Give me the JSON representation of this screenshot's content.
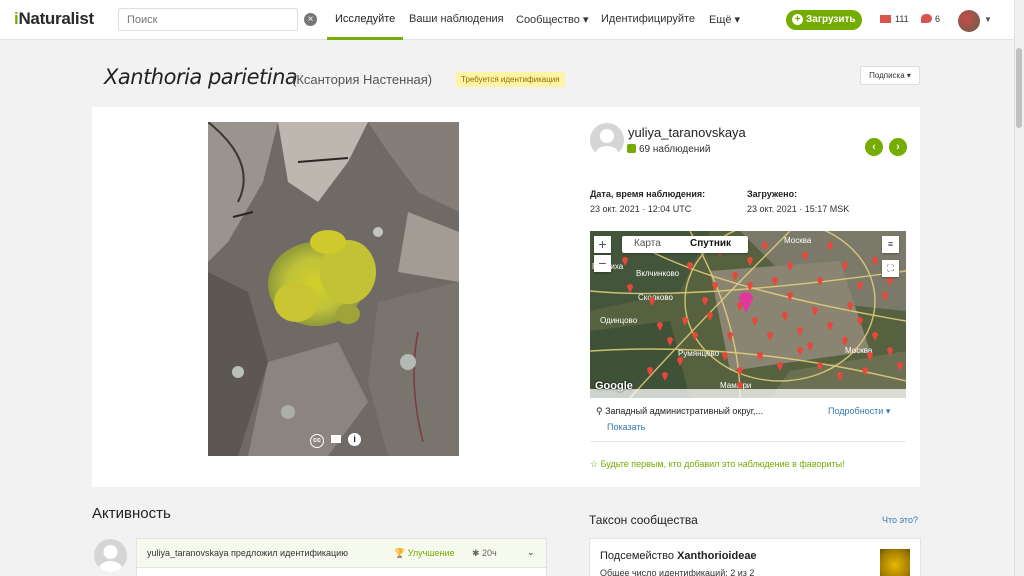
{
  "nav": {
    "logo_i": "i",
    "logo_rest": "Naturalist",
    "search_placeholder": "Поиск",
    "links": [
      "Исследуйте",
      "Ваши наблюдения",
      "Сообщество ▾",
      "Идентифицируйте",
      "Ещё ▾"
    ],
    "upload_label": "Загрузить",
    "messages_count": "111",
    "notifications_count": "6"
  },
  "observation": {
    "scientific_name": "Xanthoria parietina",
    "common_name": "(Ксантория Настенная)",
    "quality_badge": "Требуется идентификация",
    "subscribe_label": "Подписка ▾",
    "user_name": "yuliya_taranovskaya",
    "user_obs_count": "69 наблюдений",
    "date_label": "Дата, время наблюдения:",
    "date_value": "23 окт. 2021 · 12:04 UTC",
    "uploaded_label": "Загружено:",
    "uploaded_value": "23 окт. 2021 · 15:17 MSK",
    "photo_cc": "cc",
    "photo_info": "i"
  },
  "map": {
    "tab_map": "Карта",
    "tab_satellite": "Спутник",
    "zoom_in": "+",
    "zoom_out": "−",
    "layers_icon": "layers-icon",
    "fullscreen_icon": "fullscreen-icon",
    "google_label": "Google",
    "place": "Западный административный округ,...",
    "details_link": "Подробности ▾",
    "show_link": "Показать",
    "city_labels": [
      "Москва",
      "Одинцово",
      "Сколково",
      "Румянцево",
      "Мамыри",
      "Москва",
      "Вклчинково",
      "Барвиха"
    ]
  },
  "favorite_text": "Будьте первым, кто добавил это наблюдение в фавориты!",
  "activity": {
    "heading": "Активность",
    "entry_text": "yuliya_taranovskaya предложил идентификацию",
    "entry_tag": "Улучшение",
    "entry_time": "20ч"
  },
  "taxon": {
    "heading": "Таксон сообщества",
    "what_link": "Что это?",
    "rank": "Подсемейство",
    "name": "Xanthorioideae",
    "ids_text": "Общее число идентификаций: 2 из 2"
  },
  "colors": {
    "brand_green": "#74ac00",
    "link_blue": "#337ab7",
    "badge_yellow": "#fff3a6",
    "alert_red": "#d9534f"
  }
}
